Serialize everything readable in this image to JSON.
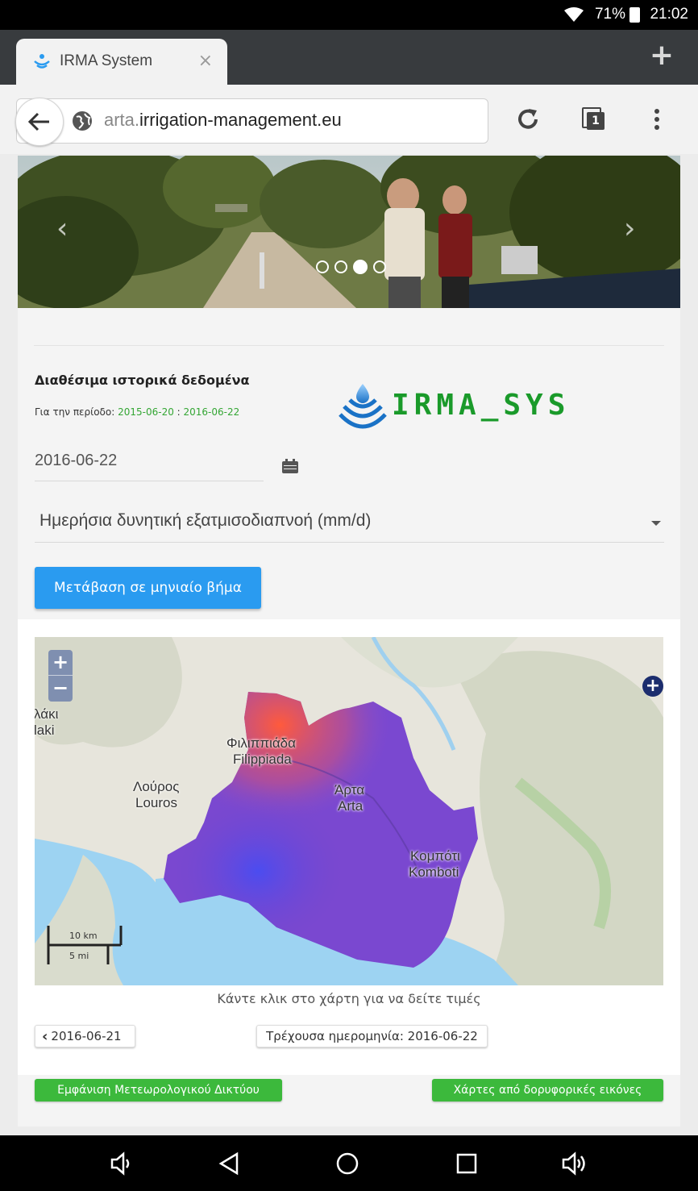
{
  "status_bar": {
    "battery": "71%",
    "time": "21:02"
  },
  "browser": {
    "tab_title": "IRMA System",
    "tab_close": "×",
    "url_subdomain": "arta.",
    "url_domain": "irrigation-management.eu",
    "tabs_count": "1"
  },
  "carousel": {
    "prev": "‹",
    "next": "›",
    "active_slide": 3,
    "slide_count": 4
  },
  "form": {
    "heading": "Διαθέσιμα ιστορικά δεδομένα",
    "period_label": "Για την περίοδο: ",
    "period_start": "2015-06-20",
    "period_sep": " : ",
    "period_end": "2016-06-22",
    "date_value": "2016-06-22",
    "variable_selected": "Ημερήσια δυνητική εξατμισοδιαπνοή (mm/d)",
    "monthly_button": "Μετάβαση σε μηνιαίο βήμα"
  },
  "logo": {
    "text": "IRMA_SYS",
    "color": "#1a9a2a"
  },
  "map": {
    "zoom_in": "+",
    "zoom_out": "−",
    "layers_button": "+",
    "labels": {
      "lakki_gr": "λάκι",
      "lakki_en": "laki",
      "filippiada_gr": "Φιλιππιάδα",
      "filippiada_en": "Filippiada",
      "louros_gr": "Λούρος",
      "louros_en": "Louros",
      "arta_gr": "Άρτα",
      "arta_en": "Arta",
      "komboti_gr": "Κομπότι",
      "komboti_en": "Komboti"
    },
    "scale_km": "10 km",
    "scale_mi": "5 mi",
    "caption": "Κάντε κλικ στο χάρτη για να δείτε τιμές"
  },
  "navigation": {
    "prev_icon": "‹",
    "prev_date": "2016-06-21",
    "current_date": "Τρέχουσα ημερομηνία: 2016-06-22"
  },
  "actions": {
    "weather_network": "Εμφάνιση Μετεωρολογικού Δικτύου",
    "satellite_maps": "Χάρτες από δορυφορικές εικόνες"
  },
  "colors": {
    "primary_blue": "#2a9bf0",
    "green": "#3cb93c",
    "period_green": "#34a634"
  }
}
